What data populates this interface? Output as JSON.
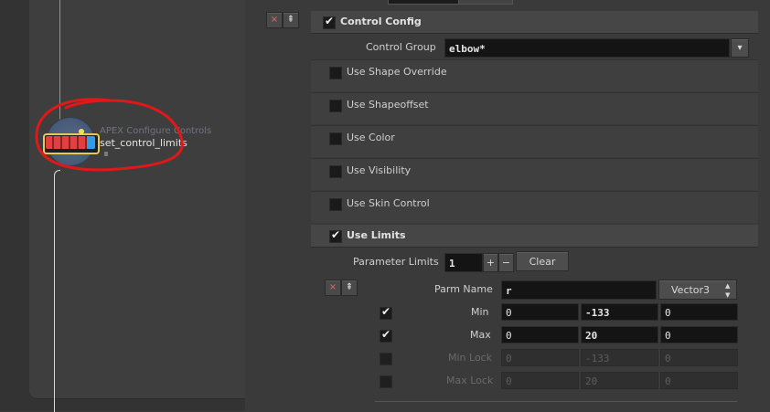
{
  "network": {
    "node_type": "APEX Configure Controls",
    "node_name": "set_control_limits",
    "edge_fragment": "- ... -  ... た"
  },
  "panel": {
    "control_config": {
      "title": "Control Config",
      "control_group_label": "Control Group",
      "control_group_value": "elbow*"
    },
    "toggles": [
      {
        "label": "Use Shape Override",
        "checked": false
      },
      {
        "label": "Use Shapeoffset",
        "checked": false
      },
      {
        "label": "Use Color",
        "checked": false
      },
      {
        "label": "Use Visibility",
        "checked": false
      },
      {
        "label": "Use Skin Control",
        "checked": false
      }
    ],
    "limits": {
      "title": "Use Limits",
      "checked": true,
      "parameter_limits_label": "Parameter Limits",
      "parameter_limits_value": "1",
      "plus": "+",
      "minus": "−",
      "clear": "Clear",
      "parm_name_label": "Parm Name",
      "parm_name_value": "r",
      "type_value": "Vector3",
      "rows": [
        {
          "label": "Min",
          "enabled": true,
          "values": [
            "0",
            "-133",
            "0"
          ]
        },
        {
          "label": "Max",
          "enabled": true,
          "values": [
            "0",
            "20",
            "0"
          ]
        },
        {
          "label": "Min Lock",
          "enabled": false,
          "values": [
            "0",
            "-133",
            "0"
          ]
        },
        {
          "label": "Max Lock",
          "enabled": false,
          "values": [
            "0",
            "20",
            "0"
          ]
        }
      ]
    }
  },
  "icons": {
    "close": "×",
    "insert": "⇞",
    "stepper": "▲▼",
    "dropdown": "▾"
  },
  "colors": {
    "node_red": "#e24040",
    "node_blue": "#2e9de8",
    "node_border": "#e8c85a",
    "annotation": "#e01818"
  }
}
